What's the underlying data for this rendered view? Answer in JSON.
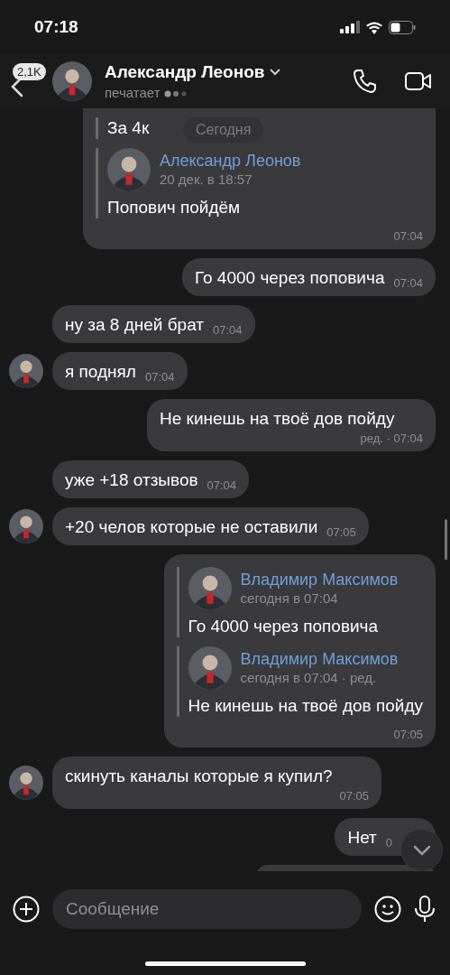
{
  "status_bar": {
    "time": "07:18"
  },
  "header": {
    "back_badge": "2,1K",
    "name": "Александр Леонов",
    "status": "печатает",
    "typing": true
  },
  "date_pill": "Сегодня",
  "messages": [
    {
      "kind": "outgoing",
      "quotes": [
        {
          "text": "За 4к"
        },
        {
          "name": "Александр Леонов",
          "date": "20 дек. в 18:57",
          "text": "Попович пойдём"
        }
      ],
      "time": "07:04"
    },
    {
      "kind": "outgoing",
      "text": "Го 4000 через поповича",
      "time": "07:04"
    },
    {
      "kind": "incoming",
      "avatar": false,
      "text": "ну за 8 дней брат",
      "time": "07:04"
    },
    {
      "kind": "incoming",
      "avatar": true,
      "text": "я поднял",
      "time": "07:04"
    },
    {
      "kind": "outgoing",
      "text": "Не кинешь на твоё дов пойду",
      "time": "ред. · 07:04"
    },
    {
      "kind": "incoming",
      "avatar": false,
      "text": "уже +18 отзывов",
      "time": "07:04"
    },
    {
      "kind": "incoming",
      "avatar": true,
      "text": "+20 челов которые не оставили",
      "time": "07:05"
    },
    {
      "kind": "outgoing",
      "quotes": [
        {
          "name": "Владимир Максимов",
          "date": "сегодня в 07:04",
          "text": "Го 4000 через поповича"
        },
        {
          "name": "Владимир Максимов",
          "date": "сегодня в 07:04 · ред.",
          "text": "Не кинешь на твоё дов пойду"
        }
      ],
      "time": "07:05"
    },
    {
      "kind": "incoming",
      "avatar": true,
      "text": "скинуть каналы которые я купил?",
      "time": "07:05"
    },
    {
      "kind": "outgoing",
      "text": "Нет",
      "time": "0"
    },
    {
      "kind": "clipped"
    }
  ],
  "composer": {
    "placeholder": "Сообщение"
  }
}
